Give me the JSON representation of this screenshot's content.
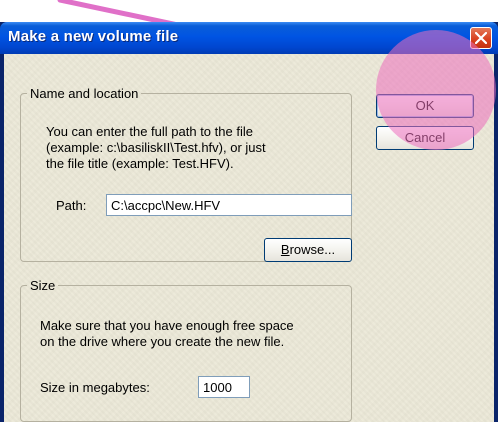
{
  "window": {
    "title": "Make a new volume file"
  },
  "name_location": {
    "legend": "Name and location",
    "description": [
      "You can enter the full path to the file",
      "(example: c:\\basiliskII\\Test.hfv), or just",
      "the file title (example: Test.HFV)."
    ],
    "path_label": "Path:",
    "path_value": "C:\\accpc\\New.HFV",
    "browse_label": "rowse...",
    "browse_mnemonic": "B"
  },
  "size": {
    "legend": "Size",
    "description": [
      "Make sure that you have enough free space",
      "on the drive where you create the new file."
    ],
    "size_label": "Size in megabytes:",
    "size_value": "1000"
  },
  "buttons": {
    "ok": "OK",
    "cancel": "Cancel"
  },
  "colors": {
    "titlebar": "#0054e3",
    "dialog_bg": "#ece9d8",
    "highlight": "#ec6ebe"
  }
}
